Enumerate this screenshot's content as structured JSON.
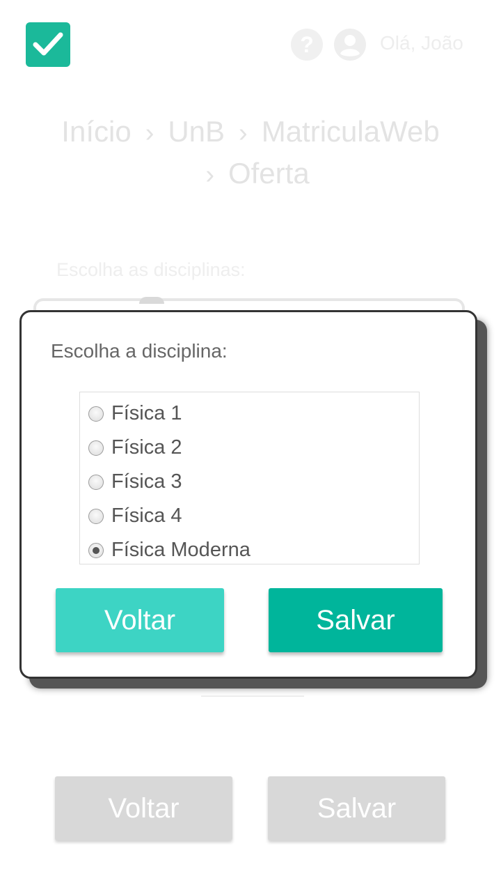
{
  "header": {
    "greeting": "Olá, João",
    "help_symbol": "?",
    "icons": [
      "check-logo-icon",
      "help-icon",
      "user-avatar-icon"
    ],
    "brand_color": "#1bb99a"
  },
  "breadcrumb": {
    "items": [
      "Início",
      "UnB",
      "MatriculaWeb",
      "Oferta"
    ],
    "separator": "›"
  },
  "form": {
    "label": "Escolha as disciplinas:"
  },
  "footer": {
    "back_label": "Voltar",
    "save_label": "Salvar"
  },
  "modal": {
    "title": "Escolha a disciplina:",
    "options": [
      {
        "label": "Física 1",
        "checked": false
      },
      {
        "label": "Física 2",
        "checked": false
      },
      {
        "label": "Física 3",
        "checked": false
      },
      {
        "label": "Física 4",
        "checked": false
      },
      {
        "label": "Física Moderna",
        "checked": true
      }
    ],
    "back_label": "Voltar",
    "save_label": "Salvar",
    "back_color": "#3dd4c4",
    "save_color": "#00b59b"
  }
}
